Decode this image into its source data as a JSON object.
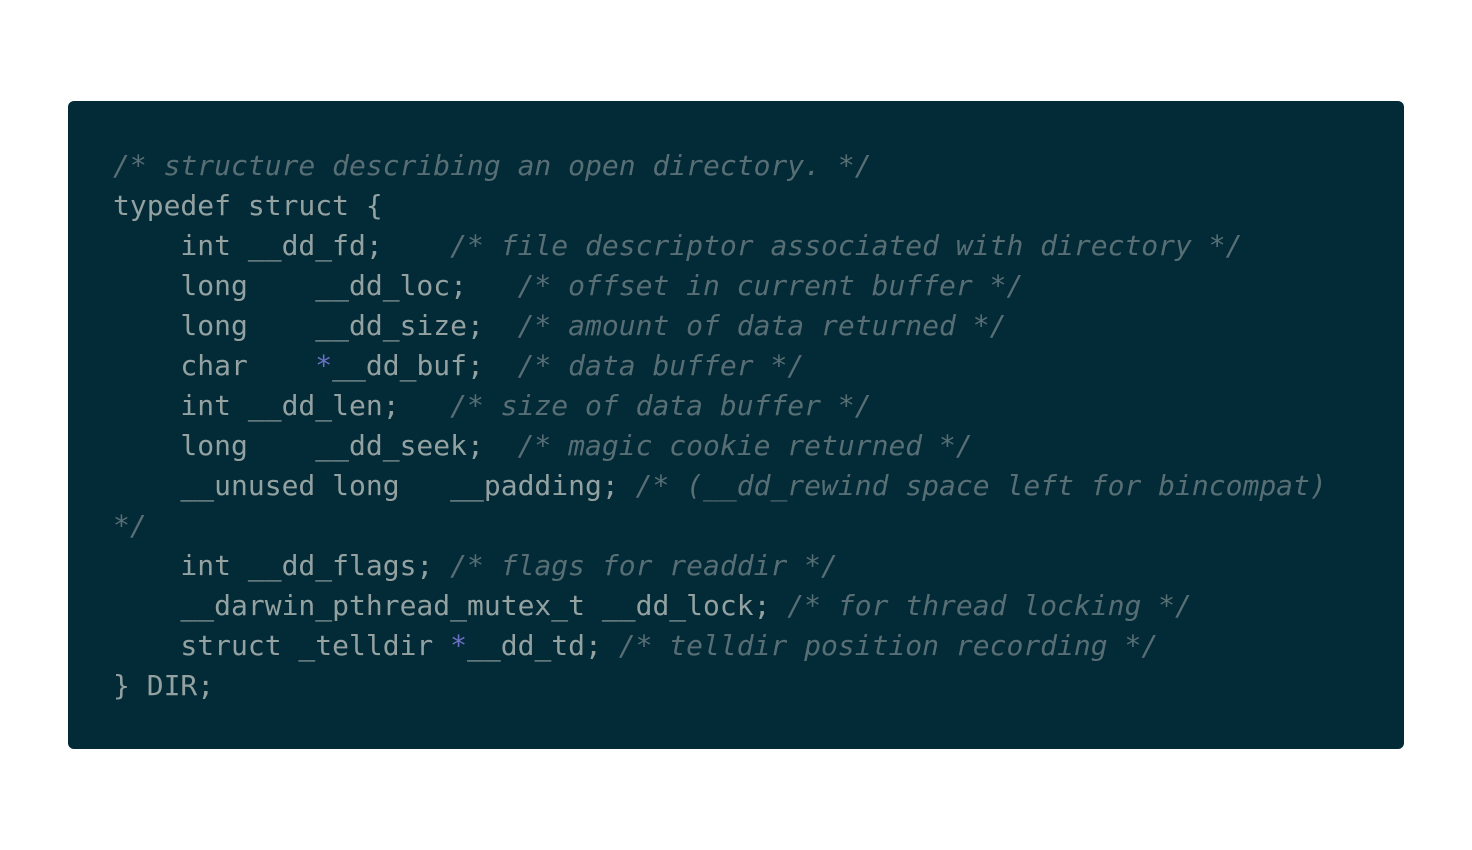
{
  "colors": {
    "background": "#022a37",
    "text": "#93a1a1",
    "comment": "#586e75",
    "operator": "#6c71c4",
    "page": "#ffffff"
  },
  "code": {
    "lines": [
      [
        {
          "t": "comment",
          "v": "/* structure describing an open directory. */"
        }
      ],
      [
        {
          "t": "plain",
          "v": "typedef struct {"
        }
      ],
      [
        {
          "t": "plain",
          "v": "    int __dd_fd;    "
        },
        {
          "t": "comment",
          "v": "/* file descriptor associated with directory */"
        }
      ],
      [
        {
          "t": "plain",
          "v": "    long    __dd_loc;   "
        },
        {
          "t": "comment",
          "v": "/* offset in current buffer */"
        }
      ],
      [
        {
          "t": "plain",
          "v": "    long    __dd_size;  "
        },
        {
          "t": "comment",
          "v": "/* amount of data returned */"
        }
      ],
      [
        {
          "t": "plain",
          "v": "    char    "
        },
        {
          "t": "op",
          "v": "*"
        },
        {
          "t": "plain",
          "v": "__dd_buf;  "
        },
        {
          "t": "comment",
          "v": "/* data buffer */"
        }
      ],
      [
        {
          "t": "plain",
          "v": "    int __dd_len;   "
        },
        {
          "t": "comment",
          "v": "/* size of data buffer */"
        }
      ],
      [
        {
          "t": "plain",
          "v": "    long    __dd_seek;  "
        },
        {
          "t": "comment",
          "v": "/* magic cookie returned */"
        }
      ],
      [
        {
          "t": "plain",
          "v": "    __unused long   __padding; "
        },
        {
          "t": "comment",
          "v": "/* (__dd_rewind space left for bincompat)"
        }
      ],
      [
        {
          "t": "comment",
          "v": "*/"
        }
      ],
      [
        {
          "t": "plain",
          "v": "    int __dd_flags; "
        },
        {
          "t": "comment",
          "v": "/* flags for readdir */"
        }
      ],
      [
        {
          "t": "plain",
          "v": "    __darwin_pthread_mutex_t __dd_lock; "
        },
        {
          "t": "comment",
          "v": "/* for thread locking */"
        }
      ],
      [
        {
          "t": "plain",
          "v": "    struct _telldir "
        },
        {
          "t": "op",
          "v": "*"
        },
        {
          "t": "plain",
          "v": "__dd_td; "
        },
        {
          "t": "comment",
          "v": "/* telldir position recording */"
        }
      ],
      [
        {
          "t": "plain",
          "v": "} DIR;"
        }
      ]
    ]
  }
}
